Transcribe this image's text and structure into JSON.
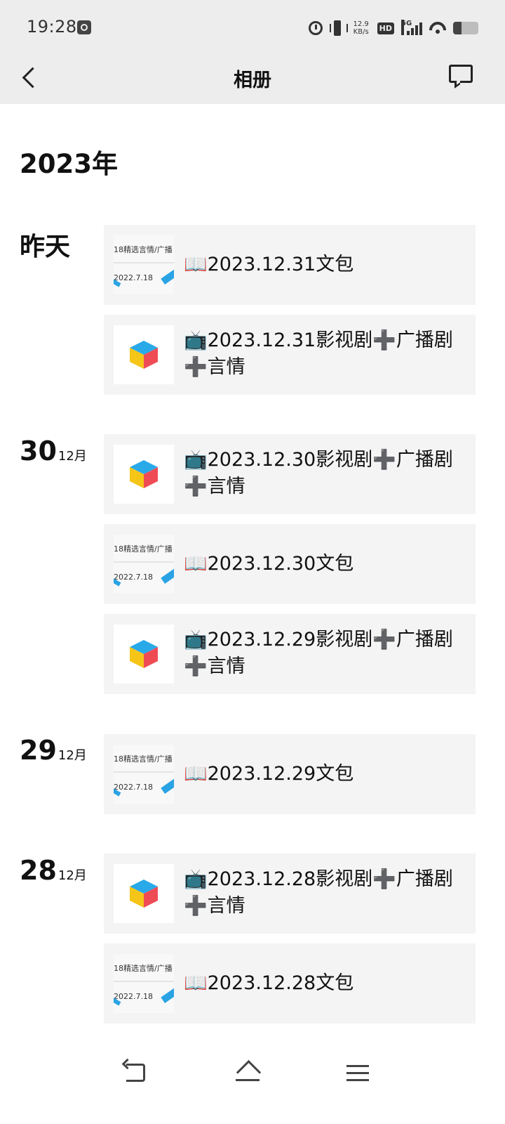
{
  "status_bar": {
    "time": "19:28",
    "net_speed_value": "12.9",
    "net_speed_unit": "KB/s",
    "hd_label": "HD",
    "network_label": "5G",
    "icons": [
      "settings-icon",
      "alarm-icon",
      "vibrate-icon",
      "signal-icon",
      "wifi-icon",
      "battery-icon"
    ]
  },
  "header": {
    "title": "相册"
  },
  "year_label": "2023年",
  "groups": [
    {
      "day_label": "昨天",
      "day_num": "",
      "month": "",
      "items": [
        {
          "thumb": "text",
          "title": "📖2023.12.31文包"
        },
        {
          "thumb": "cube",
          "title": "📺2023.12.31影视剧➕广播剧➕言情"
        }
      ]
    },
    {
      "day_label": "",
      "day_num": "30",
      "month": "12月",
      "items": [
        {
          "thumb": "cube",
          "title": "📺2023.12.30影视剧➕广播剧➕言情"
        },
        {
          "thumb": "text",
          "title": "📖2023.12.30文包"
        },
        {
          "thumb": "cube",
          "title": "📺2023.12.29影视剧➕广播剧➕言情"
        }
      ]
    },
    {
      "day_label": "",
      "day_num": "29",
      "month": "12月",
      "items": [
        {
          "thumb": "text",
          "title": "📖2023.12.29文包"
        }
      ]
    },
    {
      "day_label": "",
      "day_num": "28",
      "month": "12月",
      "items": [
        {
          "thumb": "cube",
          "title": "📺2023.12.28影视剧➕广播剧➕言情"
        },
        {
          "thumb": "text",
          "title": "📖2023.12.28文包"
        }
      ]
    }
  ],
  "thumb_text": {
    "line1": "18精选言情/广播",
    "line2": "2022.7.18"
  },
  "colors": {
    "cube_top": "#29a9e8",
    "cube_left": "#f5c518",
    "cube_right": "#ef4b55",
    "accent_blue": "#29a3e4"
  }
}
